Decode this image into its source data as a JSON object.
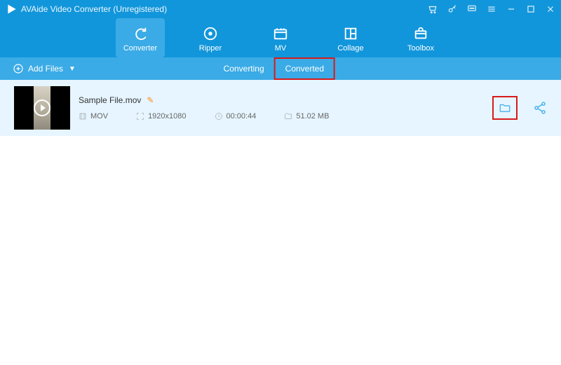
{
  "titlebar": {
    "appTitle": "AVAide Video Converter (Unregistered)"
  },
  "nav": {
    "items": [
      {
        "label": "Converter"
      },
      {
        "label": "Ripper"
      },
      {
        "label": "MV"
      },
      {
        "label": "Collage"
      },
      {
        "label": "Toolbox"
      }
    ]
  },
  "subbar": {
    "addFilesLabel": "Add Files",
    "tabs": {
      "converting": "Converting",
      "converted": "Converted"
    }
  },
  "file": {
    "name": "Sample File.mov",
    "format": "MOV",
    "resolution": "1920x1080",
    "duration": "00:00:44",
    "size": "51.02 MB"
  }
}
